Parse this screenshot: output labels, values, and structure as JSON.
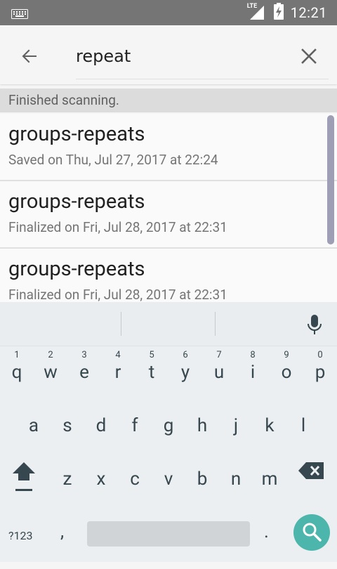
{
  "status": {
    "network": "LTE",
    "time": "12:21"
  },
  "search": {
    "value": "repeat"
  },
  "notice": "Finished scanning.",
  "items": [
    {
      "title": "groups-repeats",
      "subtitle": "Saved on Thu, Jul 27, 2017 at 22:24"
    },
    {
      "title": "groups-repeats",
      "subtitle": "Finalized on Fri, Jul 28, 2017 at 22:31"
    },
    {
      "title": "groups-repeats",
      "subtitle": "Finalized on Fri, Jul 28, 2017 at 22:31"
    }
  ],
  "keyboard": {
    "row1": [
      "q",
      "w",
      "e",
      "r",
      "t",
      "y",
      "u",
      "i",
      "o",
      "p"
    ],
    "row1_hints": [
      "1",
      "2",
      "3",
      "4",
      "5",
      "6",
      "7",
      "8",
      "9",
      "0"
    ],
    "row2": [
      "a",
      "s",
      "d",
      "f",
      "g",
      "h",
      "j",
      "k",
      "l"
    ],
    "row3": [
      "z",
      "x",
      "c",
      "v",
      "b",
      "n",
      "m"
    ],
    "symbols_label": "?123",
    "comma": ",",
    "period": "."
  },
  "colors": {
    "accent": "#4db6ac",
    "statusbar": "#757575"
  }
}
